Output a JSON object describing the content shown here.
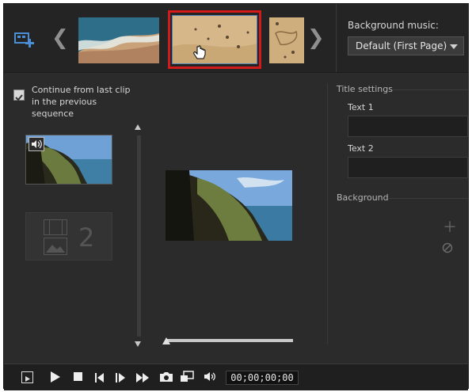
{
  "toolbar": {
    "add_clip_icon": "add-media-icon",
    "prev_icon": "chevron-left-icon",
    "next_icon": "chevron-right-icon",
    "background_music_label": "Background music:",
    "background_music_value": "Default (First Page)"
  },
  "left": {
    "continue_label_line1": "Continue from last clip",
    "continue_label_line2": "in the previous",
    "continue_label_line3": "sequence",
    "continue_checked": true,
    "slot_number": "2"
  },
  "title_settings": {
    "header": "Title settings",
    "text1_label": "Text 1",
    "text1_value": "",
    "text2_label": "Text 2",
    "text2_value": "",
    "background_header": "Background"
  },
  "player": {
    "timecode": "00;00;00;00",
    "scrub_position": 0
  }
}
